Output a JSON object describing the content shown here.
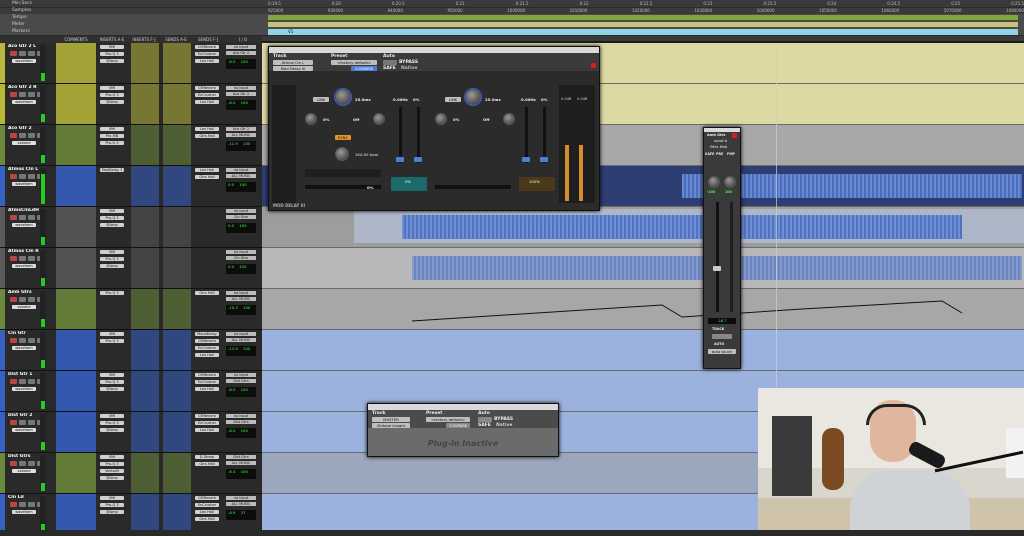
{
  "rulers": {
    "rows": [
      "Min:Secs",
      "Samples",
      "Tempo",
      "Meter",
      "Markers"
    ],
    "min_secs_ticks": [
      "0:19.5",
      "0:20",
      "0:20.5",
      "0:21",
      "0:21.5",
      "0:22",
      "0:22.5",
      "0:23",
      "0:23.5",
      "0:24",
      "0:24.5",
      "0:25",
      "0:25.5"
    ],
    "sample_ticks": [
      "925000",
      "930000",
      "940000",
      "950000",
      "1000000",
      "1010000",
      "1020000",
      "1030000",
      "1040000",
      "1050000",
      "1060000",
      "1070000",
      "1080000"
    ]
  },
  "columns": [
    "COMMENTS",
    "INSERTS A-E",
    "INSERTS F-J",
    "SENDS A-E",
    "SENDS F-J",
    "I / O"
  ],
  "marker_label": "V1",
  "tracks": [
    {
      "name": "Aco Gtr 2 L",
      "color": "#b7b73a",
      "sel": "waveform",
      "vol": "-6.0",
      "pan": "100",
      "io_in": "no input",
      "io_out": "Aco Gtr 2",
      "inserts": [
        "VMI",
        "Pro-Q 3",
        "@Amp"
      ],
      "sends": [
        "CMReverb",
        "EnCrusher",
        "Lex Hall"
      ]
    },
    {
      "name": "Aco Gtr 2 R",
      "color": "#b7b73a",
      "sel": "waveform",
      "vol": "-6.0",
      "pan": "100",
      "io_in": "no input",
      "io_out": "Aco Gtr 2",
      "inserts": [
        "VMI",
        "Pro-Q 3",
        "@Amp"
      ],
      "sends": [
        "CMReverb",
        "EnCrusher",
        "Lex Hall"
      ]
    },
    {
      "name": "Aco Gtr 2",
      "color": "#6d8a3c",
      "sel": "volume",
      "vol": "-11.9",
      "pan": "100",
      "io_in": "Aco Gtr 2",
      "io_out": "ALL MUSIC",
      "inserts": [
        "VMI",
        "Pro-MB",
        "Pro-Q 3"
      ],
      "sends": [
        "Lex Hall",
        "Gtrs Hall"
      ]
    },
    {
      "name": "Atmos Cln L",
      "color": "#3560c4",
      "sel": "waveform",
      "vol": "0.0",
      "pan": "100",
      "io_in": "no input",
      "io_out": "ALL MUSIC",
      "inserts": [
        "ModDelay 3"
      ],
      "sends": [
        "Lex Hall",
        "Gtrs Hall"
      ]
    },
    {
      "name": "AtmsClnLdH",
      "color": "#5a5a5a",
      "sel": "waveform",
      "vol": "0.0",
      "pan": "100",
      "io_in": "no input",
      "io_out": "Cln Gtrs",
      "inserts": [
        "VMI",
        "Pro-Q 3",
        "@Amp"
      ],
      "sends": []
    },
    {
      "name": "Atmos Cln R",
      "color": "#5a5a5a",
      "sel": "waveform",
      "vol": "0.0",
      "pan": "100",
      "io_in": "no input",
      "io_out": "Cln Gtrs",
      "inserts": [
        "VMI",
        "Pro-Q 3",
        "@Amp"
      ],
      "sends": []
    },
    {
      "name": "Amb Gtrs",
      "color": "#6d8a3c",
      "sel": "volume",
      "vol": "-10.3",
      "pan": "100",
      "io_in": "no input",
      "io_out": "ALL MUSIC",
      "inserts": [
        "Pro-Q 3"
      ],
      "sends": [
        "Gtrs Hall"
      ]
    },
    {
      "name": "Cln Gtr",
      "color": "#3560c4",
      "sel": "waveform",
      "vol": "-11.9",
      "pan": "100",
      "io_in": "no input",
      "io_out": "ALL MUSIC",
      "inserts": [
        "VMI",
        "Pro-Q 3"
      ],
      "sends": [
        "MondDelay",
        "CMReverb",
        "EnCrusher",
        "Lex Hall"
      ]
    },
    {
      "name": "Dist Gtr 1",
      "color": "#3560c4",
      "sel": "waveform",
      "vol": "-8.0",
      "pan": "100",
      "io_in": "no input",
      "io_out": "Dist Gtrs",
      "inserts": [
        "VMI",
        "Pro-Q 3",
        "@Amp"
      ],
      "sends": [
        "CMReverb",
        "EnCrusher",
        "Lex Hall"
      ]
    },
    {
      "name": "Dist Gtr 2",
      "color": "#3560c4",
      "sel": "waveform",
      "vol": "-8.0",
      "pan": "100",
      "io_in": "no input",
      "io_out": "Dist Gtrs",
      "inserts": [
        "VMI",
        "Pro-Q 3",
        "@Amp"
      ],
      "sends": [
        "CMReverb",
        "EnCrusher",
        "Lex Hall"
      ]
    },
    {
      "name": "Dist Gtrs",
      "color": "#6d8a3c",
      "sel": "volume",
      "vol": "-6.4",
      "pan": "100",
      "io_in": "Dist Gtrs",
      "io_out": "ALL MUSIC",
      "inserts": [
        "VMI",
        "Pro-Q 3",
        "VectorB",
        "@Amp"
      ],
      "sends": [
        "D-Dbmp",
        "Gtrs Hall"
      ]
    },
    {
      "name": "Cln Ld",
      "color": "#3560c4",
      "sel": "waveform",
      "vol": "-8.9",
      "pan": "37",
      "io_in": "no input",
      "io_out": "ALL MUSIC",
      "inserts": [
        "VMI",
        "Pro-Q 3",
        "@Amp"
      ],
      "sends": [
        "CMReverb",
        "EnCrusher",
        "Lex Hall",
        "Gtrs Hall"
      ]
    }
  ],
  "mod_delay": {
    "title": "MOD DELAY III",
    "track_label": "Track",
    "preset_label": "Preset",
    "auto_label": "Auto",
    "track_name": "Atmos Cln L",
    "insert_name": "Mod Delay III",
    "preset_name": "<factory default>",
    "compare": "COMPARE",
    "bypass": "BYPASS",
    "safe": "SAFE",
    "native": "Native",
    "left": {
      "link": "LINK",
      "delay": "25.0ms",
      "fbk": "0%",
      "lpf": "Off",
      "depth": "0%",
      "rate": "0.00Hz",
      "sync": "SYNC",
      "tempo": "184.00 bpm",
      "mix": "0%",
      "gain": "0%"
    },
    "right": {
      "link": "LINK",
      "delay": "25.0ms",
      "fbk": "0%",
      "lpf": "Off",
      "depth": "0%",
      "rate": "0.00Hz",
      "mix": "100%",
      "gain": "0%"
    },
    "meter_vals": [
      "0.0dB",
      "0.0dB"
    ]
  },
  "inactive_plugin": {
    "track_label": "Track",
    "preset_label": "Preset",
    "auto_label": "Auto",
    "track_name": "MASTER",
    "preset_name": "<factory default>",
    "insert_name": "iZotope Insight",
    "compare": "COMPARE",
    "bypass": "BYPASS",
    "safe": "SAFE",
    "native": "Native",
    "status": "Plug-in Inactive"
  },
  "mini_strip": {
    "name": "Amb Gtrs",
    "send": "send b",
    "dest": "Gtrs Hall",
    "buttons": [
      "SAFE",
      "PRE",
      "FMP"
    ],
    "pan_vals": [
      "-100",
      "100"
    ],
    "level": "-16.7",
    "track_label": "TRACK",
    "auto_label": "AUTO",
    "auto_mode": "auto touch"
  },
  "colors": {
    "edit_bg": "#9a9a9a",
    "waveform": "#5b7fd1",
    "selected_track": "#3560c4",
    "accent_blue": "#2c63d6"
  }
}
